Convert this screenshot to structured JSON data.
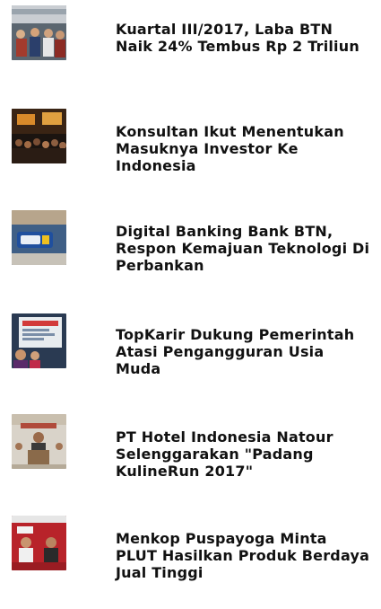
{
  "news": [
    {
      "title": "Kuartal III/2017, Laba BTN Naik 24% Tembus Rp 2 Triliun",
      "thumbnail": "event-crowd-photo"
    },
    {
      "title": "Konsultan Ikut Menentukan Masuknya Investor Ke Indonesia",
      "thumbnail": "conference-stage-photo"
    },
    {
      "title": "Digital Banking Bank BTN, Respon Kemajuan Teknologi Di Perbankan",
      "thumbnail": "btn-signage-photo"
    },
    {
      "title": "TopKarir Dukung Pemerintah Atasi Pengangguran Usia Muda",
      "thumbnail": "presentation-screen-photo"
    },
    {
      "title": "PT Hotel Indonesia Natour Selenggarakan \"Padang KulineRun 2017\"",
      "thumbnail": "speaker-podium-photo"
    },
    {
      "title": "Menkop Puspayoga Minta PLUT Hasilkan Produk Berdaya Jual Tinggi",
      "thumbnail": "ceremony-red-backdrop-photo"
    }
  ]
}
